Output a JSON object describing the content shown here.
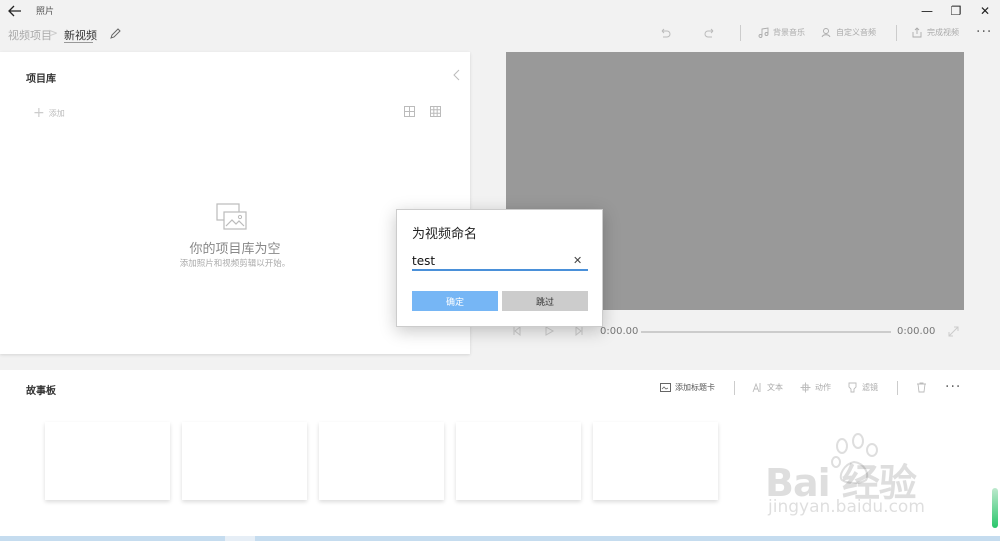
{
  "window": {
    "title": "照片",
    "minimize_glyph": "—",
    "restore_glyph": "❐",
    "close_glyph": "✕"
  },
  "toolbar": {
    "breadcrumb_project": "视频项目",
    "breadcrumb_sep": ">",
    "breadcrumb_current": "新视频",
    "background_music": "背景音乐",
    "custom_audio": "自定义音频",
    "finish_video": "完成视频",
    "more": "···"
  },
  "library": {
    "title": "项目库",
    "add_label": "添加",
    "empty_title": "你的项目库为空",
    "empty_subtitle": "添加照片和视频剪辑以开始。"
  },
  "player": {
    "time_start": "0:00.00",
    "time_end": "0:00.00",
    "progress": 0
  },
  "storyboard": {
    "title": "故事板",
    "add_title_card": "添加标题卡",
    "text": "文本",
    "motion": "动作",
    "filters": "滤镜",
    "more": "···"
  },
  "dialog": {
    "title": "为视频命名",
    "input_value": "test",
    "clear_glyph": "✕",
    "ok_label": "确定",
    "skip_label": "跳过"
  },
  "watermark": {
    "main": "Bai  经验",
    "sub": "jingyan.baidu.com"
  },
  "colors": {
    "accent": "#4a90d9",
    "ok_button": "#76b6f5",
    "preview": "#999999"
  }
}
